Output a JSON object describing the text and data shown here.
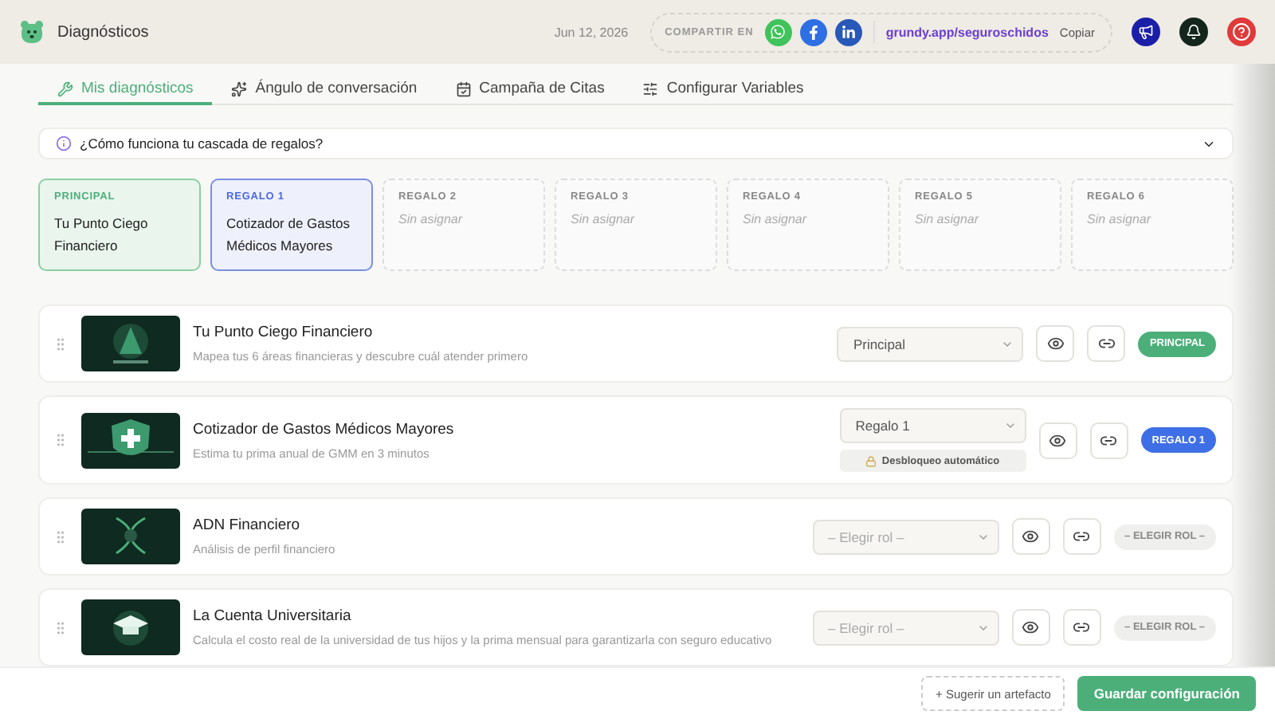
{
  "header": {
    "title": "Diagnósticos",
    "date": "Jun 12, 2026",
    "share": {
      "label": "COMPARTIR EN",
      "link": "grundy.app/seguroschidos",
      "copy": "Copiar"
    }
  },
  "tabs": [
    {
      "label": "Mis diagnósticos",
      "selected": true
    },
    {
      "label": "Ángulo de conversación",
      "selected": false
    },
    {
      "label": "Campaña de Citas",
      "selected": false
    },
    {
      "label": "Configurar Variables",
      "selected": false
    }
  ],
  "accordion": {
    "title": "¿Cómo funciona tu cascada de regalos?",
    "expanded": false
  },
  "slots": [
    {
      "label": "PRINCIPAL",
      "kind": "principal",
      "title": "Tu Punto Ciego Financiero"
    },
    {
      "label": "REGALO 1",
      "kind": "regalo",
      "title": "Cotizador de Gastos Médicos Mayores"
    },
    {
      "label": "REGALO 2",
      "kind": "empty",
      "placeholder": "Sin asignar"
    },
    {
      "label": "REGALO 3",
      "kind": "empty",
      "placeholder": "Sin asignar"
    },
    {
      "label": "REGALO 4",
      "kind": "empty",
      "placeholder": "Sin asignar"
    },
    {
      "label": "REGALO 5",
      "kind": "empty",
      "placeholder": "Sin asignar"
    },
    {
      "label": "REGALO 6",
      "kind": "empty",
      "placeholder": "Sin asignar"
    }
  ],
  "diagnostics": [
    {
      "title": "Tu Punto Ciego Financiero",
      "description": "Mapea tus 6 áreas financieras y descubre cuál atender primero",
      "select": {
        "value": "Principal"
      },
      "badge": {
        "text": "PRINCIPAL",
        "kind": "principal"
      }
    },
    {
      "title": "Cotizador de Gastos Médicos Mayores",
      "description": "Estima tu prima anual de GMM en 3 minutos",
      "select": {
        "value": "Regalo 1"
      },
      "note": "Desbloqueo automático",
      "badge": {
        "text": "REGALO 1",
        "kind": "regalo"
      }
    },
    {
      "title": "ADN Financiero",
      "description": "Análisis de perfil financiero",
      "select": {
        "placeholder": "– Elegir rol –"
      },
      "badge": {
        "text": "– ELEGIR ROL –",
        "kind": "none"
      }
    },
    {
      "title": "La Cuenta Universitaria",
      "description": "Calcula el costo real de la universidad de tus hijos y la prima mensual para garantizarla con seguro educativo",
      "select": {
        "placeholder": "– Elegir rol –"
      },
      "badge": {
        "text": "– ELEGIR ROL –",
        "kind": "none"
      }
    }
  ],
  "footer": {
    "suggest": "+ Sugerir un artefacto",
    "save": "Guardar configuración"
  }
}
